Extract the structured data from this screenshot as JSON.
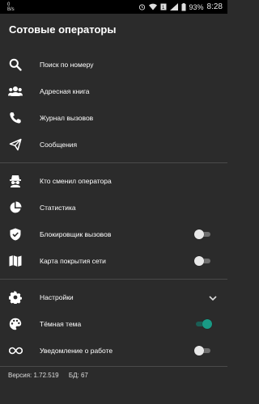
{
  "status": {
    "left": "0\nB/s",
    "battery": "93%",
    "time": "8:28"
  },
  "app": {
    "title": "Сотовые операторы"
  },
  "menu": {
    "search": "Поиск по номеру",
    "address_book": "Адресная книга",
    "call_log": "Журнал вызовов",
    "messages": "Сообщения",
    "who_changed": "Кто сменил оператора",
    "statistics": "Статистика",
    "call_blocker": "Блокировщик вызовов",
    "coverage_map": "Карта покрытия сети",
    "settings": "Настройки",
    "dark_theme": "Тёмная тема",
    "work_notification": "Уведомление о работе"
  },
  "toggles": {
    "call_blocker": false,
    "coverage_map": false,
    "dark_theme": true,
    "work_notification": false
  },
  "footer": {
    "version": "Версия: 1.72.519",
    "db": "БД: 67"
  },
  "colors": {
    "background": "#2b2b2b",
    "accent": "#199a85",
    "statusbar": "#000000"
  }
}
